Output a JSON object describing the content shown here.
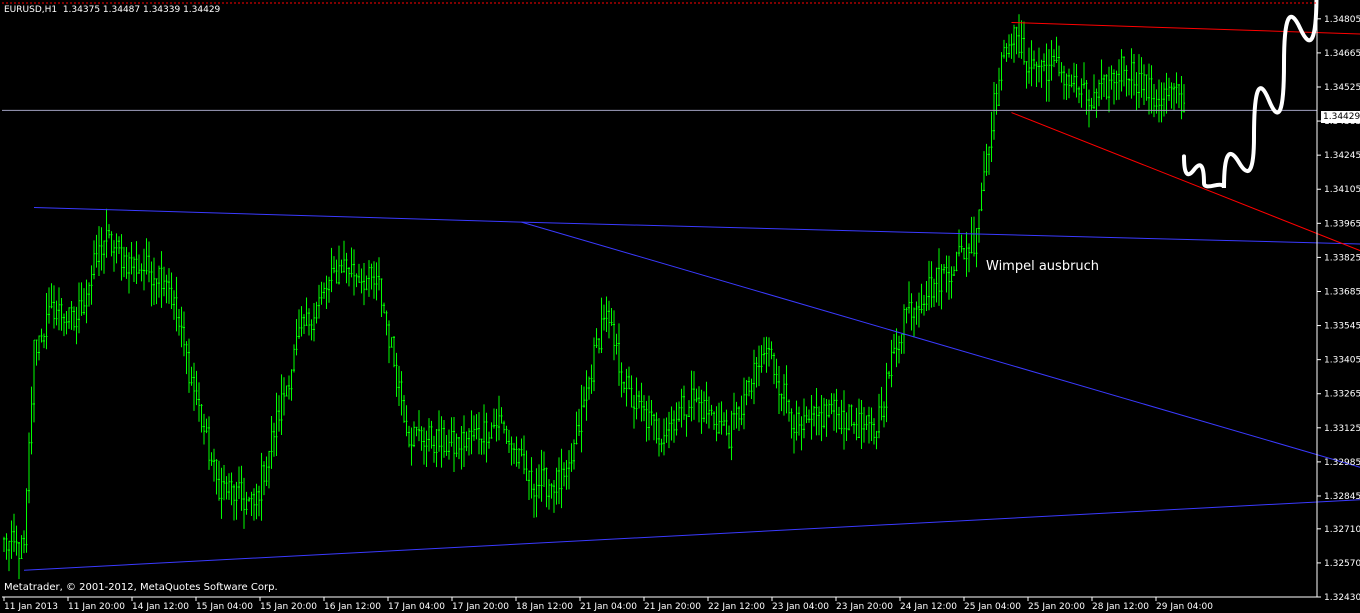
{
  "title": "EURUSD,H1  1.34375 1.34487 1.34339 1.34429",
  "copyright": "Metatrader, © 2001-2012, MetaQuotes Software Corp.",
  "current_price": "1.34429",
  "annotation": "Wimpel ausbruch",
  "colors": {
    "background": "#000000",
    "candle": "#00ff00",
    "axis": "#ffffff",
    "trendline_blue": "#3a3aff",
    "trendline_red": "#ff0000",
    "bid_line": "#a0a0c0",
    "projection": "#ffffff"
  },
  "chart_data": {
    "type": "candlestick",
    "symbol": "EURUSD",
    "timeframe": "H1",
    "ylim": [
      1.3243,
      1.3487
    ],
    "y_ticks": [
      "1.34805",
      "1.34665",
      "1.34525",
      "1.34385",
      "1.34245",
      "1.34105",
      "1.33965",
      "1.33825",
      "1.33685",
      "1.33545",
      "1.33405",
      "1.33265",
      "1.33125",
      "1.32985",
      "1.32845",
      "1.32710",
      "1.32570",
      "1.32430"
    ],
    "x_ticks": [
      "11 Jan 2013",
      "11 Jan 20:00",
      "14 Jan 12:00",
      "15 Jan 04:00",
      "15 Jan 20:00",
      "16 Jan 12:00",
      "17 Jan 04:00",
      "17 Jan 20:00",
      "18 Jan 12:00",
      "21 Jan 04:00",
      "21 Jan 20:00",
      "22 Jan 12:00",
      "23 Jan 04:00",
      "23 Jan 20:00",
      "24 Jan 12:00",
      "25 Jan 04:00",
      "25 Jan 20:00",
      "28 Jan 12:00",
      "29 Jan 04:00"
    ],
    "key_prices": [
      {
        "i": 0,
        "p": 1.3265
      },
      {
        "i": 8,
        "p": 1.3262
      },
      {
        "i": 12,
        "p": 1.3345
      },
      {
        "i": 20,
        "p": 1.3362
      },
      {
        "i": 28,
        "p": 1.3355
      },
      {
        "i": 40,
        "p": 1.339
      },
      {
        "i": 50,
        "p": 1.338
      },
      {
        "i": 65,
        "p": 1.3375
      },
      {
        "i": 85,
        "p": 1.329
      },
      {
        "i": 100,
        "p": 1.328
      },
      {
        "i": 118,
        "p": 1.335
      },
      {
        "i": 135,
        "p": 1.338
      },
      {
        "i": 150,
        "p": 1.337
      },
      {
        "i": 162,
        "p": 1.331
      },
      {
        "i": 180,
        "p": 1.3305
      },
      {
        "i": 198,
        "p": 1.3315
      },
      {
        "i": 210,
        "p": 1.329
      },
      {
        "i": 225,
        "p": 1.329
      },
      {
        "i": 240,
        "p": 1.336
      },
      {
        "i": 250,
        "p": 1.3325
      },
      {
        "i": 262,
        "p": 1.331
      },
      {
        "i": 275,
        "p": 1.3325
      },
      {
        "i": 290,
        "p": 1.331
      },
      {
        "i": 305,
        "p": 1.3345
      },
      {
        "i": 318,
        "p": 1.331
      },
      {
        "i": 330,
        "p": 1.332
      },
      {
        "i": 348,
        "p": 1.331
      },
      {
        "i": 360,
        "p": 1.336
      },
      {
        "i": 375,
        "p": 1.3375
      },
      {
        "i": 388,
        "p": 1.339
      },
      {
        "i": 395,
        "p": 1.344
      },
      {
        "i": 402,
        "p": 1.3475
      },
      {
        "i": 410,
        "p": 1.3462
      },
      {
        "i": 422,
        "p": 1.346
      },
      {
        "i": 435,
        "p": 1.3445
      },
      {
        "i": 448,
        "p": 1.3462
      },
      {
        "i": 460,
        "p": 1.3448
      },
      {
        "i": 468,
        "p": 1.345
      },
      {
        "i": 472,
        "p": 1.3443
      }
    ],
    "trendlines": [
      {
        "color": "blue",
        "points": [
          {
            "i": 12,
            "p": 1.3403
          },
          {
            "i": 207,
            "p": 1.3397
          },
          {
            "i": 580,
            "p": 1.3387
          }
        ]
      },
      {
        "color": "blue",
        "points": [
          {
            "i": 207,
            "p": 1.3397
          },
          {
            "i": 580,
            "p": 1.3285
          }
        ]
      },
      {
        "color": "blue",
        "points": [
          {
            "i": 8,
            "p": 1.3254
          },
          {
            "i": 580,
            "p": 1.3285
          }
        ]
      },
      {
        "color": "red",
        "points": [
          {
            "i": 403,
            "p": 1.3479
          },
          {
            "i": 580,
            "p": 1.3473
          }
        ]
      },
      {
        "color": "red",
        "points": [
          {
            "i": 403,
            "p": 1.3442
          },
          {
            "i": 580,
            "p": 1.337
          }
        ]
      }
    ],
    "bid_line": 1.34429,
    "projection": [
      {
        "i": 472,
        "p": 1.3424
      },
      {
        "i": 480,
        "p": 1.3413
      },
      {
        "i": 488,
        "p": 1.3411
      },
      {
        "i": 500,
        "p": 1.3432
      },
      {
        "i": 512,
        "p": 1.3462
      },
      {
        "i": 525,
        "p": 1.3491
      }
    ]
  }
}
